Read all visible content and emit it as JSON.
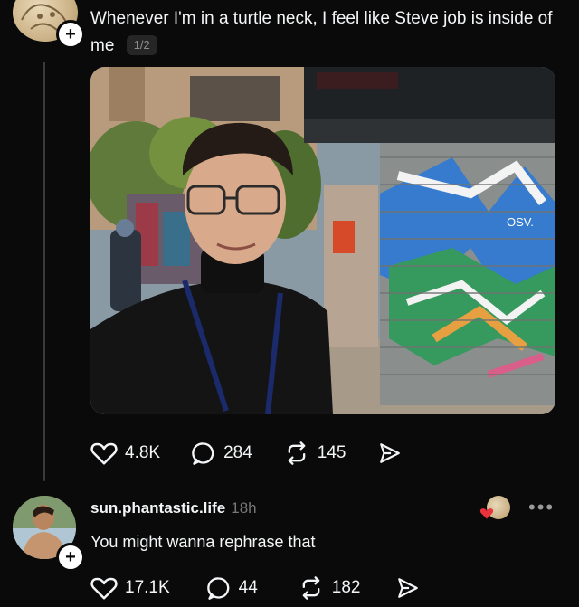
{
  "post": {
    "text": "Whenever I'm in a turtle neck, I feel like Steve job is inside of me",
    "pager": "1/2",
    "actions": {
      "likes": "4.8K",
      "comments": "284",
      "reposts": "145"
    }
  },
  "reply": {
    "username": "sun.phantastic.life",
    "time": "18h",
    "text": "You might wanna rephrase that",
    "actions": {
      "likes": "17.1K",
      "comments": "44",
      "reposts": "182"
    }
  },
  "photo_text": {
    "sign": "OSV."
  },
  "colors": {
    "background": "#0a0a0a",
    "text": "#f3f5f7",
    "muted": "#777777",
    "liked_heart": "#e8323c"
  }
}
